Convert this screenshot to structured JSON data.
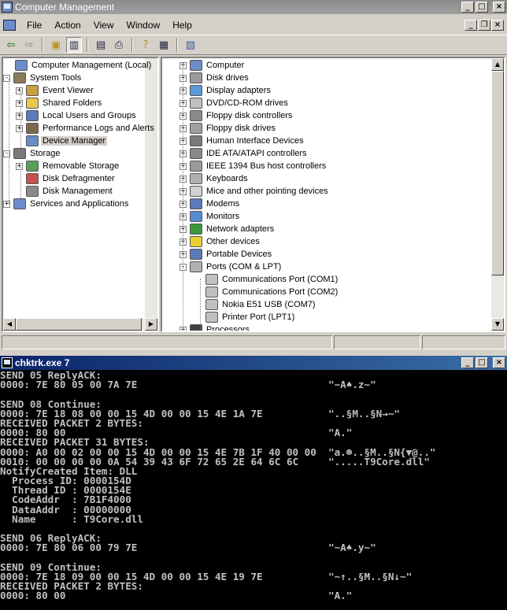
{
  "main_window": {
    "title": "Computer Management",
    "menu": [
      "File",
      "Action",
      "View",
      "Window",
      "Help"
    ]
  },
  "tree": [
    {
      "label": "Computer Management (Local)",
      "level": 0,
      "expander": "",
      "icon": "computer-management-icon",
      "color": "#6b8cc8"
    },
    {
      "label": "System Tools",
      "level": 0,
      "expander": "−",
      "icon": "system-tools-icon",
      "color": "#8a7a5a"
    },
    {
      "label": "Event Viewer",
      "level": 1,
      "expander": "+",
      "icon": "event-viewer-icon",
      "color": "#c8a040"
    },
    {
      "label": "Shared Folders",
      "level": 1,
      "expander": "+",
      "icon": "shared-folders-icon",
      "color": "#e8c84a"
    },
    {
      "label": "Local Users and Groups",
      "level": 1,
      "expander": "+",
      "icon": "users-icon",
      "color": "#5a7ab8"
    },
    {
      "label": "Performance Logs and Alerts",
      "level": 1,
      "expander": "+",
      "icon": "performance-icon",
      "color": "#7a6a4a"
    },
    {
      "label": "Device Manager",
      "level": 1,
      "expander": "",
      "icon": "device-manager-icon",
      "color": "#6b8cc8",
      "selected": true
    },
    {
      "label": "Storage",
      "level": 0,
      "expander": "−",
      "icon": "storage-icon",
      "color": "#7a7a7a"
    },
    {
      "label": "Removable Storage",
      "level": 1,
      "expander": "+",
      "icon": "removable-storage-icon",
      "color": "#58a058"
    },
    {
      "label": "Disk Defragmenter",
      "level": 1,
      "expander": "",
      "icon": "defrag-icon",
      "color": "#c85050"
    },
    {
      "label": "Disk Management",
      "level": 1,
      "expander": "",
      "icon": "disk-management-icon",
      "color": "#8a8a8a"
    },
    {
      "label": "Services and Applications",
      "level": 0,
      "expander": "+",
      "icon": "services-icon",
      "color": "#6b8cc8"
    }
  ],
  "devices": [
    {
      "label": "Computer",
      "expander": "+",
      "icon": "computer-icon",
      "color": "#6b8cc8"
    },
    {
      "label": "Disk drives",
      "expander": "+",
      "icon": "disk-drive-icon",
      "color": "#9a9a9a"
    },
    {
      "label": "Display adapters",
      "expander": "+",
      "icon": "display-adapter-icon",
      "color": "#5a9ad8"
    },
    {
      "label": "DVD/CD-ROM drives",
      "expander": "+",
      "icon": "cdrom-icon",
      "color": "#c0c0c0"
    },
    {
      "label": "Floppy disk controllers",
      "expander": "+",
      "icon": "floppy-controller-icon",
      "color": "#8a8a8a"
    },
    {
      "label": "Floppy disk drives",
      "expander": "+",
      "icon": "floppy-drive-icon",
      "color": "#a0a0a0"
    },
    {
      "label": "Human Interface Devices",
      "expander": "+",
      "icon": "hid-icon",
      "color": "#7a7a7a"
    },
    {
      "label": "IDE ATA/ATAPI controllers",
      "expander": "+",
      "icon": "ide-icon",
      "color": "#8a8a8a"
    },
    {
      "label": "IEEE 1394 Bus host controllers",
      "expander": "+",
      "icon": "ieee1394-icon",
      "color": "#9a9a9a"
    },
    {
      "label": "Keyboards",
      "expander": "+",
      "icon": "keyboard-icon",
      "color": "#b0b0b0"
    },
    {
      "label": "Mice and other pointing devices",
      "expander": "+",
      "icon": "mouse-icon",
      "color": "#d0d0d0"
    },
    {
      "label": "Modems",
      "expander": "+",
      "icon": "modem-icon",
      "color": "#5a7ab8"
    },
    {
      "label": "Monitors",
      "expander": "+",
      "icon": "monitor-icon",
      "color": "#5a8ad0"
    },
    {
      "label": "Network adapters",
      "expander": "+",
      "icon": "network-adapter-icon",
      "color": "#3a9a3a"
    },
    {
      "label": "Other devices",
      "expander": "+",
      "icon": "unknown-device-icon",
      "color": "#e8d030"
    },
    {
      "label": "Portable Devices",
      "expander": "+",
      "icon": "portable-device-icon",
      "color": "#5a7ab8"
    },
    {
      "label": "Ports (COM & LPT)",
      "expander": "−",
      "icon": "ports-icon",
      "color": "#b0b0b0"
    },
    {
      "label": "Communications Port (COM1)",
      "child": true,
      "icon": "port-icon",
      "color": "#c0c0c0"
    },
    {
      "label": "Communications Port (COM2)",
      "child": true,
      "icon": "port-icon",
      "color": "#c0c0c0"
    },
    {
      "label": "Nokia E51 USB (COM7)",
      "child": true,
      "icon": "port-icon",
      "color": "#c0c0c0"
    },
    {
      "label": "Printer Port (LPT1)",
      "child": true,
      "icon": "port-icon",
      "color": "#c0c0c0"
    },
    {
      "label": "Processors",
      "expander": "+",
      "icon": "processor-icon",
      "color": "#404040"
    }
  ],
  "console_window": {
    "title": "chktrk.exe 7",
    "lines": [
      "SEND 05 ReplyACK:",
      "0000: 7E 80 05 00 7A 7E                                \"~A♠.z~\"",
      "",
      "SEND 08 Continue:",
      "0000: 7E 18 08 00 00 15 4D 00 00 15 4E 1A 7E           \"..§M..§N→~\"",
      "RECEIVED PACKET 2 BYTES:",
      "0000: 80 00                                            \"A.\"",
      "RECEIVED PACKET 31 BYTES:",
      "0000: A0 00 02 00 00 15 4D 00 00 15 4E 7B 1F 40 00 00  \"a.☻..§M..§N{▼@..\"",
      "0010: 00 00 00 00 0A 54 39 43 6F 72 65 2E 64 6C 6C     \".....T9Core.dll\"",
      "NotifyCreated Item: DLL",
      "  Process ID: 0000154D",
      "  Thread ID : 0000154E",
      "  CodeAddr  : 7B1F4000",
      "  DataAddr  : 00000000",
      "  Name      : T9Core.dll",
      "",
      "SEND 06 ReplyACK:",
      "0000: 7E 80 06 00 79 7E                                \"~A♠.y~\"",
      "",
      "SEND 09 Continue:",
      "0000: 7E 18 09 00 00 15 4D 00 00 15 4E 19 7E           \"~↑..§M..§N↓~\"",
      "RECEIVED PACKET 2 BYTES:",
      "0000: 80 00                                            \"A.\""
    ]
  }
}
